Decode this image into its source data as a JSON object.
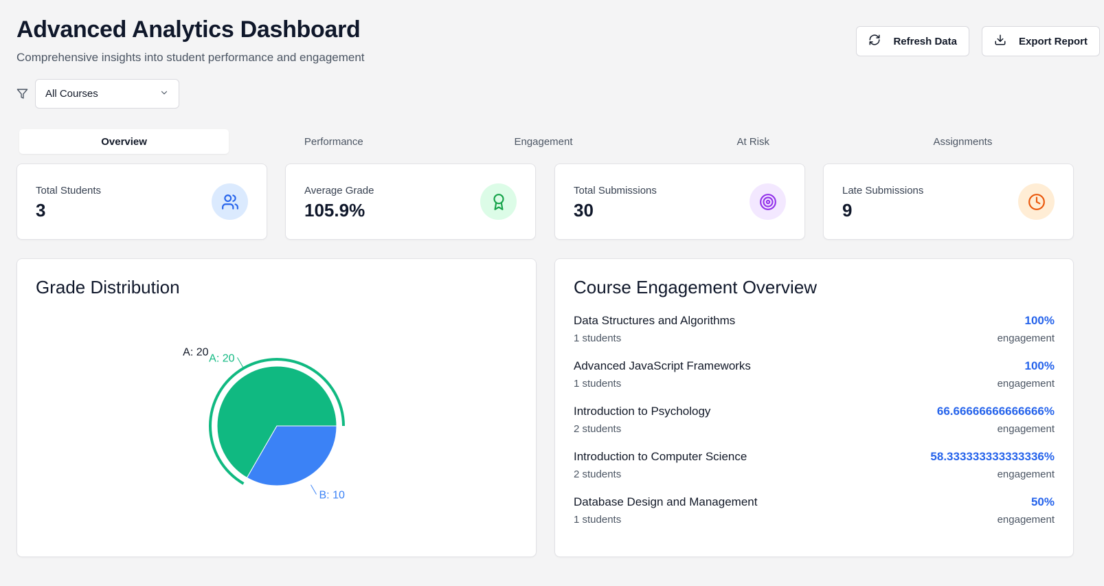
{
  "header": {
    "title": "Advanced Analytics Dashboard",
    "subtitle": "Comprehensive insights into student performance and engagement",
    "refresh_label": "Refresh Data",
    "export_label": "Export Report"
  },
  "filter": {
    "selected": "All Courses",
    "icon": "filter-icon"
  },
  "tabs": [
    {
      "label": "Overview",
      "active": true
    },
    {
      "label": "Performance",
      "active": false
    },
    {
      "label": "Engagement",
      "active": false
    },
    {
      "label": "At Risk",
      "active": false
    },
    {
      "label": "Assignments",
      "active": false
    }
  ],
  "stats": [
    {
      "label": "Total Students",
      "value": "3",
      "icon": "users-icon",
      "color": "#2563eb",
      "bg": "#dbeafe"
    },
    {
      "label": "Average Grade",
      "value": "105.9%",
      "icon": "award-icon",
      "color": "#16a34a",
      "bg": "#dcfce7"
    },
    {
      "label": "Total Submissions",
      "value": "30",
      "icon": "target-icon",
      "color": "#9333ea",
      "bg": "#f3e8ff"
    },
    {
      "label": "Late Submissions",
      "value": "9",
      "icon": "clock-icon",
      "color": "#ea580c",
      "bg": "#ffedd5"
    }
  ],
  "grade_panel": {
    "title": "Grade Distribution"
  },
  "chart_data": {
    "type": "pie",
    "labels": [
      "A",
      "B"
    ],
    "values": [
      20,
      10
    ],
    "colors": [
      "#10b981",
      "#3b82f6"
    ],
    "data_labels": [
      "A: 20",
      "B: 10"
    ],
    "active_label": "A: 20",
    "active_index": 0
  },
  "engagement_panel": {
    "title": "Course Engagement Overview",
    "items": [
      {
        "name": "Data Structures and Algorithms",
        "students": "1 students",
        "value": "100%",
        "caption": "engagement"
      },
      {
        "name": "Advanced JavaScript Frameworks",
        "students": "1 students",
        "value": "100%",
        "caption": "engagement"
      },
      {
        "name": "Introduction to Psychology",
        "students": "2 students",
        "value": "66.66666666666666%",
        "caption": "engagement"
      },
      {
        "name": "Introduction to Computer Science",
        "students": "2 students",
        "value": "58.333333333333336%",
        "caption": "engagement"
      },
      {
        "name": "Database Design and Management",
        "students": "1 students",
        "value": "50%",
        "caption": "engagement"
      }
    ]
  }
}
